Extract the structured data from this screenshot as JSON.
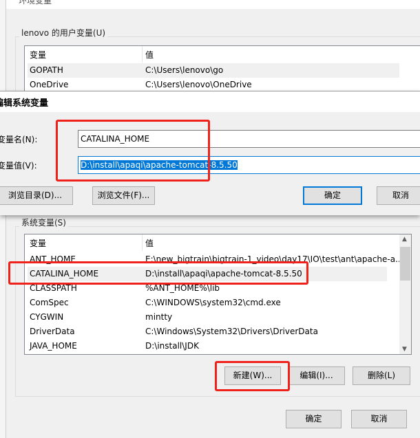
{
  "window": {
    "title": "环境变量"
  },
  "user_vars": {
    "label": "lenovo 的用户变量(U)",
    "headers": [
      "变量",
      "值"
    ],
    "rows": [
      {
        "name": "GOPATH",
        "value": "C:\\Users\\lenovo\\go"
      },
      {
        "name": "OneDrive",
        "value": "C:\\Users\\lenovo\\OneDrive"
      }
    ]
  },
  "dialog": {
    "title": "编辑系统变量",
    "name_label": "变量名(N):",
    "value_label": "变量值(V):",
    "name_value": "CATALINA_HOME",
    "value_value": "D:\\install\\apaqi\\apache-tomcat-8.5.50",
    "browse_dir": "浏览目录(D)...",
    "browse_file": "浏览文件(F)...",
    "ok": "确定",
    "cancel": "取消"
  },
  "sys_vars": {
    "label": "系统变量(S)",
    "headers": [
      "变量",
      "值"
    ],
    "rows": [
      {
        "name": "ANT_HOME",
        "value": "E:\\new_bigtrain\\bigtrain-1_video\\day17\\IO\\test\\ant\\apache-a..."
      },
      {
        "name": "CATALINA_HOME",
        "value": "D:\\install\\apaqi\\apache-tomcat-8.5.50"
      },
      {
        "name": "CLASSPATH",
        "value": "%ANT_HOME%\\lib"
      },
      {
        "name": "ComSpec",
        "value": "C:\\WINDOWS\\system32\\cmd.exe"
      },
      {
        "name": "CYGWIN",
        "value": "mintty"
      },
      {
        "name": "DriverData",
        "value": "C:\\Windows\\System32\\Drivers\\DriverData"
      },
      {
        "name": "JAVA_HOME",
        "value": "D:\\install\\JDK"
      }
    ],
    "selected_index": 1,
    "new": "新建(W)...",
    "edit": "编辑(I)...",
    "delete": "删除(L)"
  },
  "footer": {
    "ok": "确定",
    "cancel": "取消"
  },
  "colors": {
    "highlight": "#f0201a",
    "accent": "#0078d7"
  }
}
